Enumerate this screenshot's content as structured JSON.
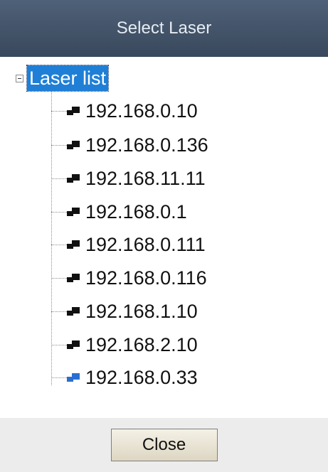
{
  "window": {
    "title": "Select Laser"
  },
  "tree": {
    "root_label": "Laser list",
    "items": [
      {
        "label": "192.168.0.10",
        "icon": "laser-device-icon"
      },
      {
        "label": "192.168.0.136",
        "icon": "laser-device-icon"
      },
      {
        "label": "192.168.11.11",
        "icon": "laser-device-icon"
      },
      {
        "label": "192.168.0.1",
        "icon": "laser-device-icon"
      },
      {
        "label": "192.168.0.111",
        "icon": "laser-device-icon"
      },
      {
        "label": "192.168.0.116",
        "icon": "laser-device-icon"
      },
      {
        "label": "192.168.1.10",
        "icon": "laser-device-icon"
      },
      {
        "label": "192.168.2.10",
        "icon": "laser-device-icon"
      },
      {
        "label": "192.168.0.33",
        "icon": "laser-device-icon-active"
      }
    ]
  },
  "footer": {
    "close_label": "Close"
  },
  "colors": {
    "titlebar": "#45546a",
    "selection": "#1f7fd6",
    "active_icon": "#2a6fcf"
  }
}
